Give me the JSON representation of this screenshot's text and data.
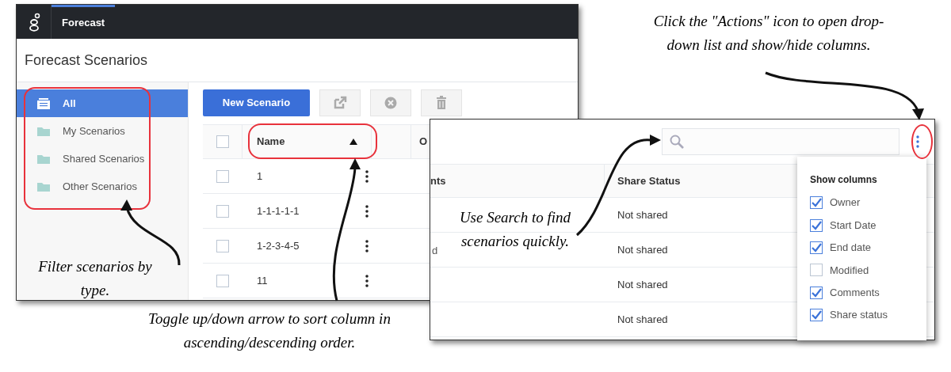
{
  "app_bar": {
    "tabs": [
      {
        "label": "Forecast",
        "selected": true
      }
    ]
  },
  "page_title": "Forecast Scenarios",
  "sidebar": {
    "items": [
      {
        "label": "All",
        "selected": true,
        "kind": "all"
      },
      {
        "label": "My Scenarios",
        "selected": false,
        "kind": "folder"
      },
      {
        "label": "Shared Scenarios",
        "selected": false,
        "kind": "folder"
      },
      {
        "label": "Other Scenarios",
        "selected": false,
        "kind": "folder"
      }
    ]
  },
  "toolbar": {
    "new_button": "New Scenario"
  },
  "table": {
    "select_all_checked": false,
    "columns": [
      {
        "label": "Name",
        "sort_ascending": true
      },
      {
        "label": "O"
      }
    ],
    "rows": [
      {
        "name": "1",
        "checked": false
      },
      {
        "name": "1-1-1-1-1",
        "checked": false
      },
      {
        "name": "1-2-3-4-5",
        "checked": false
      },
      {
        "name": "11",
        "checked": false
      }
    ]
  },
  "detail_table": {
    "columns": [
      "nts",
      "Share Status"
    ],
    "rows": [
      {
        "share_status": "Not shared"
      },
      {
        "column_1": "d",
        "share_status": "Not shared"
      },
      {
        "share_status": "Not shared"
      },
      {
        "share_status": "Not shared"
      }
    ]
  },
  "column_menu": {
    "title": "Show columns",
    "items": [
      {
        "label": "Owner",
        "checked": true
      },
      {
        "label": "Start Date",
        "checked": true
      },
      {
        "label": "End date",
        "checked": true
      },
      {
        "label": "Modified",
        "checked": false
      },
      {
        "label": "Comments",
        "checked": true
      },
      {
        "label": "Share status",
        "checked": true
      }
    ]
  },
  "annotations": [
    {
      "kind": "actions",
      "text": "Click the \"Actions\" icon to open drop-\ndown list and show/hide columns."
    },
    {
      "kind": "filter",
      "text": "Filter scenarios by\ntype."
    },
    {
      "kind": "sort",
      "text": "Toggle up/down arrow to sort column in\nascending/descending order."
    },
    {
      "kind": "search",
      "text": "Use Search to find\nscenarios quickly."
    }
  ]
}
